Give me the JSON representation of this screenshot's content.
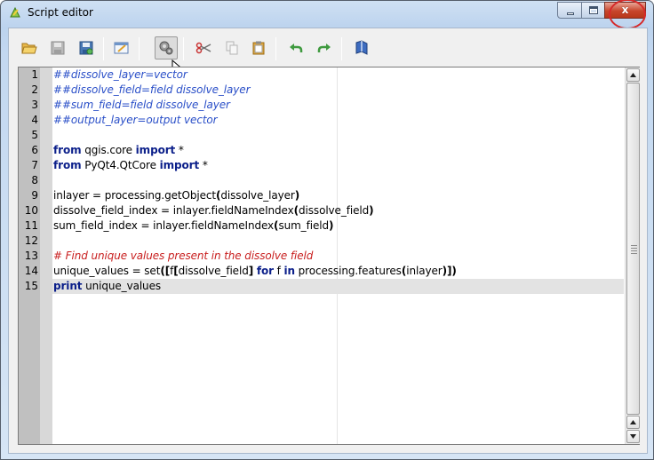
{
  "window": {
    "title": "Script editor"
  },
  "titlebar_buttons": {
    "minimize_icon": "minimize-icon",
    "maximize_icon": "maximize-icon",
    "close_glyph": "x"
  },
  "toolbar": {
    "buttons": [
      {
        "name": "open-script",
        "icon": "folder-open-icon",
        "enabled": true
      },
      {
        "name": "save-script",
        "icon": "floppy-save-icon",
        "enabled": false
      },
      {
        "name": "save-as-script",
        "icon": "floppy-save-as-icon",
        "enabled": true
      },
      {
        "name": "edit-script-help",
        "icon": "edit-help-icon",
        "enabled": true
      },
      {
        "name": "run-script",
        "icon": "gears-run-icon",
        "enabled": true,
        "pressed": true
      },
      {
        "name": "cut",
        "icon": "scissors-icon",
        "enabled": true
      },
      {
        "name": "copy",
        "icon": "copy-icon",
        "enabled": false
      },
      {
        "name": "paste",
        "icon": "clipboard-paste-icon",
        "enabled": true
      },
      {
        "name": "undo",
        "icon": "undo-arrow-icon",
        "enabled": true
      },
      {
        "name": "redo",
        "icon": "redo-arrow-icon",
        "enabled": true
      },
      {
        "name": "snippets",
        "icon": "book-icon",
        "enabled": true
      }
    ]
  },
  "editor": {
    "current_line": 15,
    "lines": [
      {
        "num": "1",
        "tokens": [
          {
            "t": "##dissolve_layer=vector",
            "c": "comment-blue"
          }
        ]
      },
      {
        "num": "2",
        "tokens": [
          {
            "t": "##dissolve_field=field dissolve_layer",
            "c": "comment-blue"
          }
        ]
      },
      {
        "num": "3",
        "tokens": [
          {
            "t": "##sum_field=field dissolve_layer",
            "c": "comment-blue"
          }
        ]
      },
      {
        "num": "4",
        "tokens": [
          {
            "t": "##output_layer=output vector",
            "c": "comment-blue"
          }
        ]
      },
      {
        "num": "5",
        "tokens": []
      },
      {
        "num": "6",
        "tokens": [
          {
            "t": "from",
            "c": "kw"
          },
          {
            "t": " qgis.core ",
            "c": ""
          },
          {
            "t": "import",
            "c": "kw"
          },
          {
            "t": " *",
            "c": ""
          }
        ]
      },
      {
        "num": "7",
        "tokens": [
          {
            "t": "from",
            "c": "kw"
          },
          {
            "t": " PyQt4.QtCore ",
            "c": ""
          },
          {
            "t": "import",
            "c": "kw"
          },
          {
            "t": " *",
            "c": ""
          }
        ]
      },
      {
        "num": "8",
        "tokens": []
      },
      {
        "num": "9",
        "tokens": [
          {
            "t": "inlayer = processing.getObject",
            "c": ""
          },
          {
            "t": "(",
            "c": "punc"
          },
          {
            "t": "dissolve_layer",
            "c": ""
          },
          {
            "t": ")",
            "c": "punc"
          }
        ]
      },
      {
        "num": "10",
        "tokens": [
          {
            "t": "dissolve_field_index = inlayer.fieldNameIndex",
            "c": ""
          },
          {
            "t": "(",
            "c": "punc"
          },
          {
            "t": "dissolve_field",
            "c": ""
          },
          {
            "t": ")",
            "c": "punc"
          }
        ]
      },
      {
        "num": "11",
        "tokens": [
          {
            "t": "sum_field_index = inlayer.fieldNameIndex",
            "c": ""
          },
          {
            "t": "(",
            "c": "punc"
          },
          {
            "t": "sum_field",
            "c": ""
          },
          {
            "t": ")",
            "c": "punc"
          }
        ]
      },
      {
        "num": "12",
        "tokens": []
      },
      {
        "num": "13",
        "tokens": [
          {
            "t": "# Find unique values present in the dissolve field",
            "c": "comment-red"
          }
        ]
      },
      {
        "num": "14",
        "tokens": [
          {
            "t": "unique_values = set",
            "c": ""
          },
          {
            "t": "([",
            "c": "punc"
          },
          {
            "t": "f",
            "c": ""
          },
          {
            "t": "[",
            "c": "punc"
          },
          {
            "t": "dissolve_field",
            "c": ""
          },
          {
            "t": "]",
            "c": "punc"
          },
          {
            "t": " ",
            "c": ""
          },
          {
            "t": "for",
            "c": "kw"
          },
          {
            "t": " f ",
            "c": ""
          },
          {
            "t": "in",
            "c": "kw"
          },
          {
            "t": " processing.features",
            "c": ""
          },
          {
            "t": "(",
            "c": "punc"
          },
          {
            "t": "inlayer",
            "c": ""
          },
          {
            "t": ")])",
            "c": "punc"
          }
        ]
      },
      {
        "num": "15",
        "tokens": [
          {
            "t": "print",
            "c": "kw"
          },
          {
            "t": " unique_values",
            "c": ""
          }
        ]
      }
    ]
  },
  "scrollbar": {
    "up_arrow": "up-arrow-icon",
    "down_arrow": "down-arrow-icon"
  }
}
